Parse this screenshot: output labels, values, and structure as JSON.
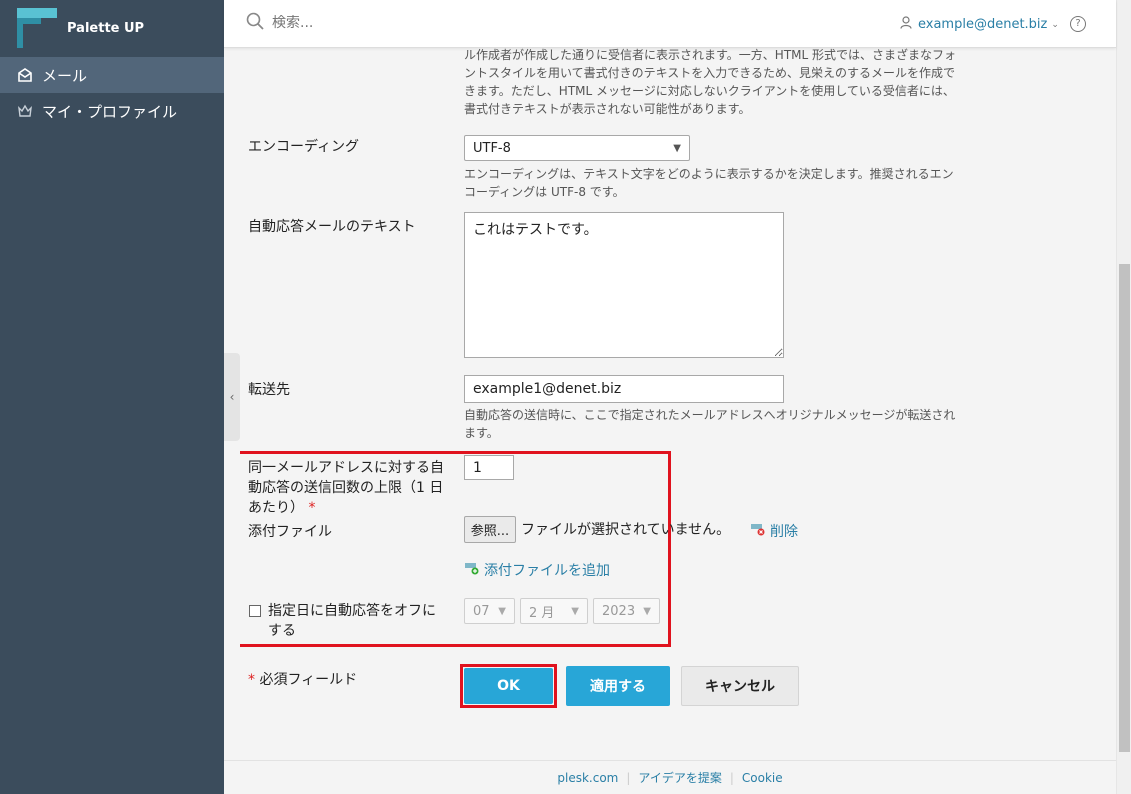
{
  "app": {
    "name": "Palette UP"
  },
  "sidebar": {
    "items": [
      {
        "label": "メール",
        "icon": "mail-icon",
        "active": true
      },
      {
        "label": "マイ・プロファイル",
        "icon": "crown-icon",
        "active": false
      }
    ]
  },
  "topbar": {
    "search_placeholder": "検索...",
    "user_email": "example@denet.biz",
    "help_label": "?"
  },
  "form": {
    "format_help": "ル作成者が作成した通りに受信者に表示されます。一方、HTML 形式では、さまざまなフォントスタイルを用いて書式付きのテキストを入力できるため、見栄えのするメールを作成できます。ただし、HTML メッセージに対応しないクライアントを使用している受信者には、書式付きテキストが表示されない可能性があります。",
    "encoding": {
      "label": "エンコーディング",
      "value": "UTF-8",
      "help": "エンコーディングは、テキスト文字をどのように表示するかを決定します。推奨されるエンコーディングは UTF-8 です。"
    },
    "autoreply_text": {
      "label": "自動応答メールのテキスト",
      "value": "これはテストです。"
    },
    "forward": {
      "label": "転送先",
      "value": "example1@denet.biz",
      "help": "自動応答の送信時に、ここで指定されたメールアドレスへオリジナルメッセージが転送されます。"
    },
    "limit": {
      "label": "同一メールアドレスに対する自動応答の送信回数の上限（1 日あたり）",
      "required_mark": "*",
      "value": "1"
    },
    "attachment": {
      "label": "添付ファイル",
      "browse_label": "参照...",
      "no_file_text": "ファイルが選択されていません。",
      "delete_label": "削除",
      "add_label": "添付ファイルを追加"
    },
    "turn_off": {
      "label": "指定日に自動応答をオフにする",
      "checked": false,
      "day": "07",
      "month": "2 月",
      "year": "2023"
    },
    "required_note": "必須フィールド",
    "required_star": "*",
    "buttons": {
      "ok": "OK",
      "apply": "適用する",
      "cancel": "キャンセル"
    }
  },
  "footer": {
    "links": [
      "plesk.com",
      "アイデアを提案",
      "Cookie"
    ]
  },
  "colors": {
    "sidebar_bg": "#3b4c5c",
    "accent": "#28a6d7",
    "link": "#2a7fa6",
    "highlight": "#e0121e"
  }
}
